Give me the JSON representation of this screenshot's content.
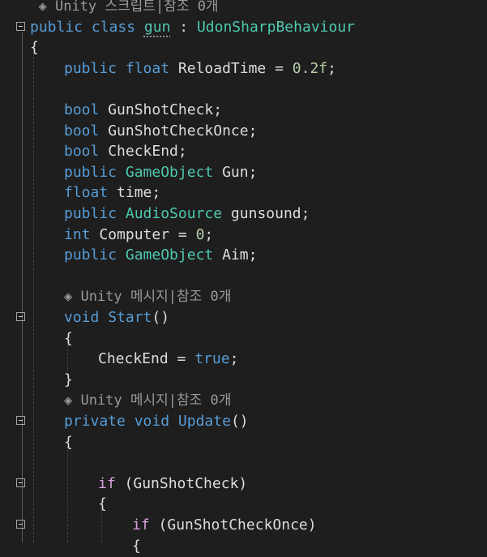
{
  "editor": {
    "lines": [
      {
        "indent": 1,
        "parts": [
          {
            "t": "◈ Unity 스크립트|참조 0개",
            "c": "lens"
          }
        ]
      },
      {
        "indent": 0,
        "fold": true,
        "parts": [
          {
            "t": "public",
            "c": "kw"
          },
          {
            "t": " "
          },
          {
            "t": "class",
            "c": "kw"
          },
          {
            "t": " "
          },
          {
            "t": "gun",
            "c": "type squiggle"
          },
          {
            "t": " : "
          },
          {
            "t": "UdonSharpBehaviour",
            "c": "type"
          }
        ]
      },
      {
        "indent": 0,
        "parts": [
          {
            "t": "{"
          }
        ]
      },
      {
        "indent": 4,
        "parts": [
          {
            "t": "public",
            "c": "kw"
          },
          {
            "t": " "
          },
          {
            "t": "float",
            "c": "kw"
          },
          {
            "t": " ReloadTime = "
          },
          {
            "t": "0.2f",
            "c": "num"
          },
          {
            "t": ";"
          }
        ]
      },
      {
        "indent": 4,
        "parts": []
      },
      {
        "indent": 4,
        "parts": [
          {
            "t": "bool",
            "c": "kw"
          },
          {
            "t": " GunShotCheck;"
          }
        ]
      },
      {
        "indent": 4,
        "parts": [
          {
            "t": "bool",
            "c": "kw"
          },
          {
            "t": " GunShotCheckOnce;"
          }
        ]
      },
      {
        "indent": 4,
        "parts": [
          {
            "t": "bool",
            "c": "kw"
          },
          {
            "t": " CheckEnd;"
          }
        ]
      },
      {
        "indent": 4,
        "parts": [
          {
            "t": "public",
            "c": "kw"
          },
          {
            "t": " "
          },
          {
            "t": "GameObject",
            "c": "type"
          },
          {
            "t": " Gun;"
          }
        ]
      },
      {
        "indent": 4,
        "parts": [
          {
            "t": "float",
            "c": "kw"
          },
          {
            "t": " time;"
          }
        ]
      },
      {
        "indent": 4,
        "parts": [
          {
            "t": "public",
            "c": "kw"
          },
          {
            "t": " "
          },
          {
            "t": "AudioSource",
            "c": "type"
          },
          {
            "t": " gunsound;"
          }
        ]
      },
      {
        "indent": 4,
        "parts": [
          {
            "t": "int",
            "c": "kw"
          },
          {
            "t": " Computer = "
          },
          {
            "t": "0",
            "c": "num"
          },
          {
            "t": ";"
          }
        ]
      },
      {
        "indent": 4,
        "parts": [
          {
            "t": "public",
            "c": "kw"
          },
          {
            "t": " "
          },
          {
            "t": "GameObject",
            "c": "type"
          },
          {
            "t": " Aim;"
          }
        ]
      },
      {
        "indent": 4,
        "parts": []
      },
      {
        "indent": 4,
        "parts": [
          {
            "t": "◈ Unity 메시지|참조 0개",
            "c": "lens"
          }
        ]
      },
      {
        "indent": 4,
        "fold": true,
        "parts": [
          {
            "t": "void",
            "c": "kw"
          },
          {
            "t": " "
          },
          {
            "t": "Start",
            "c": "kw"
          },
          {
            "t": "()"
          }
        ]
      },
      {
        "indent": 4,
        "parts": [
          {
            "t": "{"
          }
        ]
      },
      {
        "indent": 8,
        "parts": [
          {
            "t": "CheckEnd = "
          },
          {
            "t": "true",
            "c": "kw"
          },
          {
            "t": ";"
          }
        ]
      },
      {
        "indent": 4,
        "parts": [
          {
            "t": "}"
          }
        ]
      },
      {
        "indent": 4,
        "parts": [
          {
            "t": "◈ Unity 메시지|참조 0개",
            "c": "lens"
          }
        ]
      },
      {
        "indent": 4,
        "fold": true,
        "parts": [
          {
            "t": "private",
            "c": "kw"
          },
          {
            "t": " "
          },
          {
            "t": "void",
            "c": "kw"
          },
          {
            "t": " "
          },
          {
            "t": "Update",
            "c": "kw"
          },
          {
            "t": "()"
          }
        ]
      },
      {
        "indent": 4,
        "parts": [
          {
            "t": "{"
          }
        ]
      },
      {
        "indent": 8,
        "parts": []
      },
      {
        "indent": 8,
        "fold": true,
        "parts": [
          {
            "t": "if",
            "c": "ctl"
          },
          {
            "t": " (GunShotCheck)"
          }
        ]
      },
      {
        "indent": 8,
        "parts": [
          {
            "t": "{"
          }
        ]
      },
      {
        "indent": 12,
        "fold": true,
        "parts": [
          {
            "t": "if",
            "c": "ctl"
          },
          {
            "t": " (GunShotCheckOnce)"
          }
        ]
      },
      {
        "indent": 12,
        "parts": [
          {
            "t": "{"
          }
        ]
      }
    ]
  }
}
